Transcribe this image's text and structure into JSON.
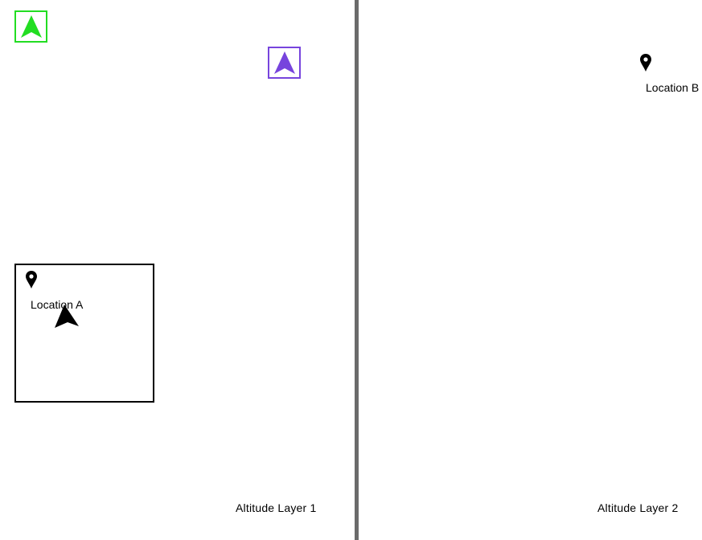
{
  "layers": [
    {
      "label": "Altitude Layer 1",
      "zone": {
        "location_label": "Location A"
      },
      "agents": [
        {
          "name": "green-agent",
          "color": "#22dd22"
        },
        {
          "name": "purple-agent",
          "color": "#7744dd"
        }
      ],
      "player": {
        "color": "#000000"
      }
    },
    {
      "label": "Altitude Layer 2",
      "location_label": "Location B"
    }
  ],
  "icons": {
    "pin": "map-pin-icon",
    "arrow": "navigation-arrow-icon"
  }
}
